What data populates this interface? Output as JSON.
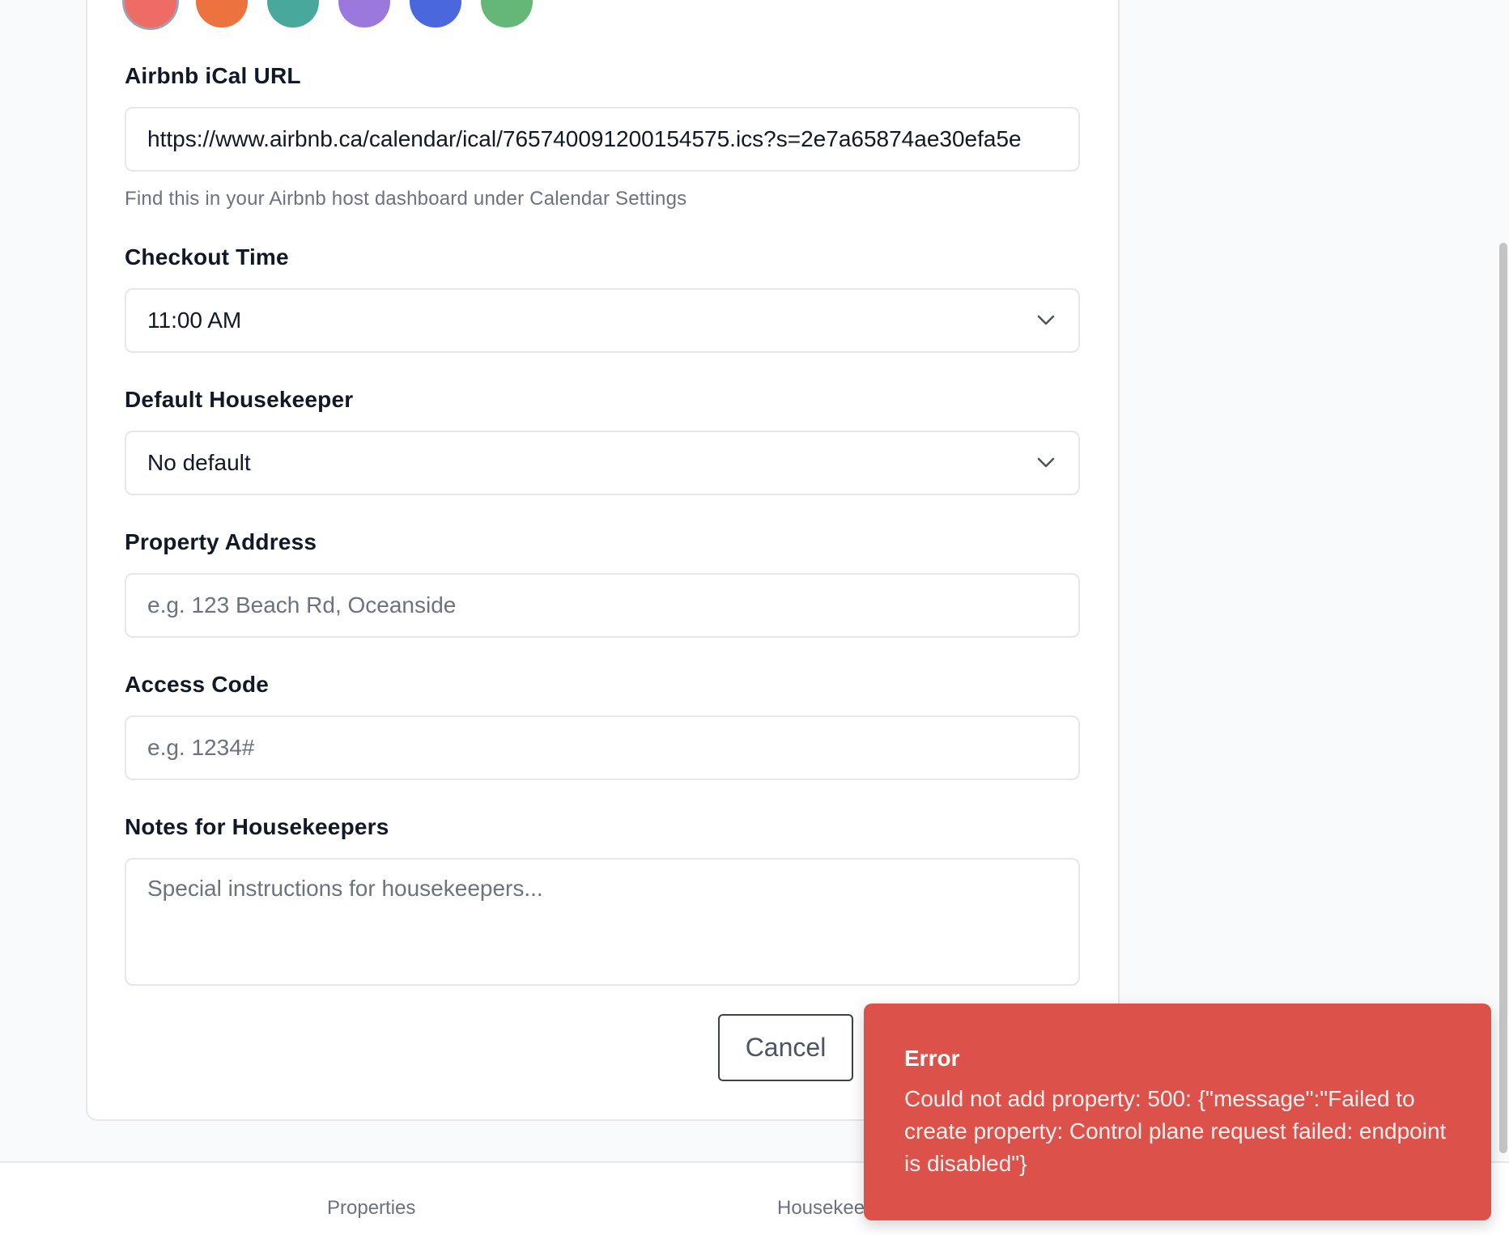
{
  "color_swatches": [
    {
      "name": "coral",
      "color": "#ee6b66",
      "selected": true
    },
    {
      "name": "orange",
      "color": "#ec7240"
    },
    {
      "name": "teal",
      "color": "#48a89b"
    },
    {
      "name": "purple",
      "color": "#9b79dc"
    },
    {
      "name": "blue",
      "color": "#4a67dd"
    },
    {
      "name": "green",
      "color": "#64b776"
    }
  ],
  "form": {
    "ical": {
      "label": "Airbnb iCal URL",
      "value": "https://www.airbnb.ca/calendar/ical/765740091200154575.ics?s=2e7a65874ae30efa5e",
      "helper": "Find this in your Airbnb host dashboard under Calendar Settings"
    },
    "checkout": {
      "label": "Checkout Time",
      "selected": "11:00 AM"
    },
    "housekeeper": {
      "label": "Default Housekeeper",
      "selected": "No default"
    },
    "address": {
      "label": "Property Address",
      "placeholder": "e.g. 123 Beach Rd, Oceanside"
    },
    "access_code": {
      "label": "Access Code",
      "placeholder": "e.g. 1234#"
    },
    "notes": {
      "label": "Notes for Housekeepers",
      "placeholder": "Special instructions for housekeepers..."
    },
    "cancel_label": "Cancel"
  },
  "bottom_nav": {
    "items": [
      {
        "label": "Properties"
      },
      {
        "label": "Housekeepers"
      }
    ]
  },
  "toast": {
    "title": "Error",
    "message": "Could not add property: 500: {\"message\":\"Failed to create property: Control plane request failed: endpoint is disabled\"}",
    "color": "#dc524b"
  }
}
